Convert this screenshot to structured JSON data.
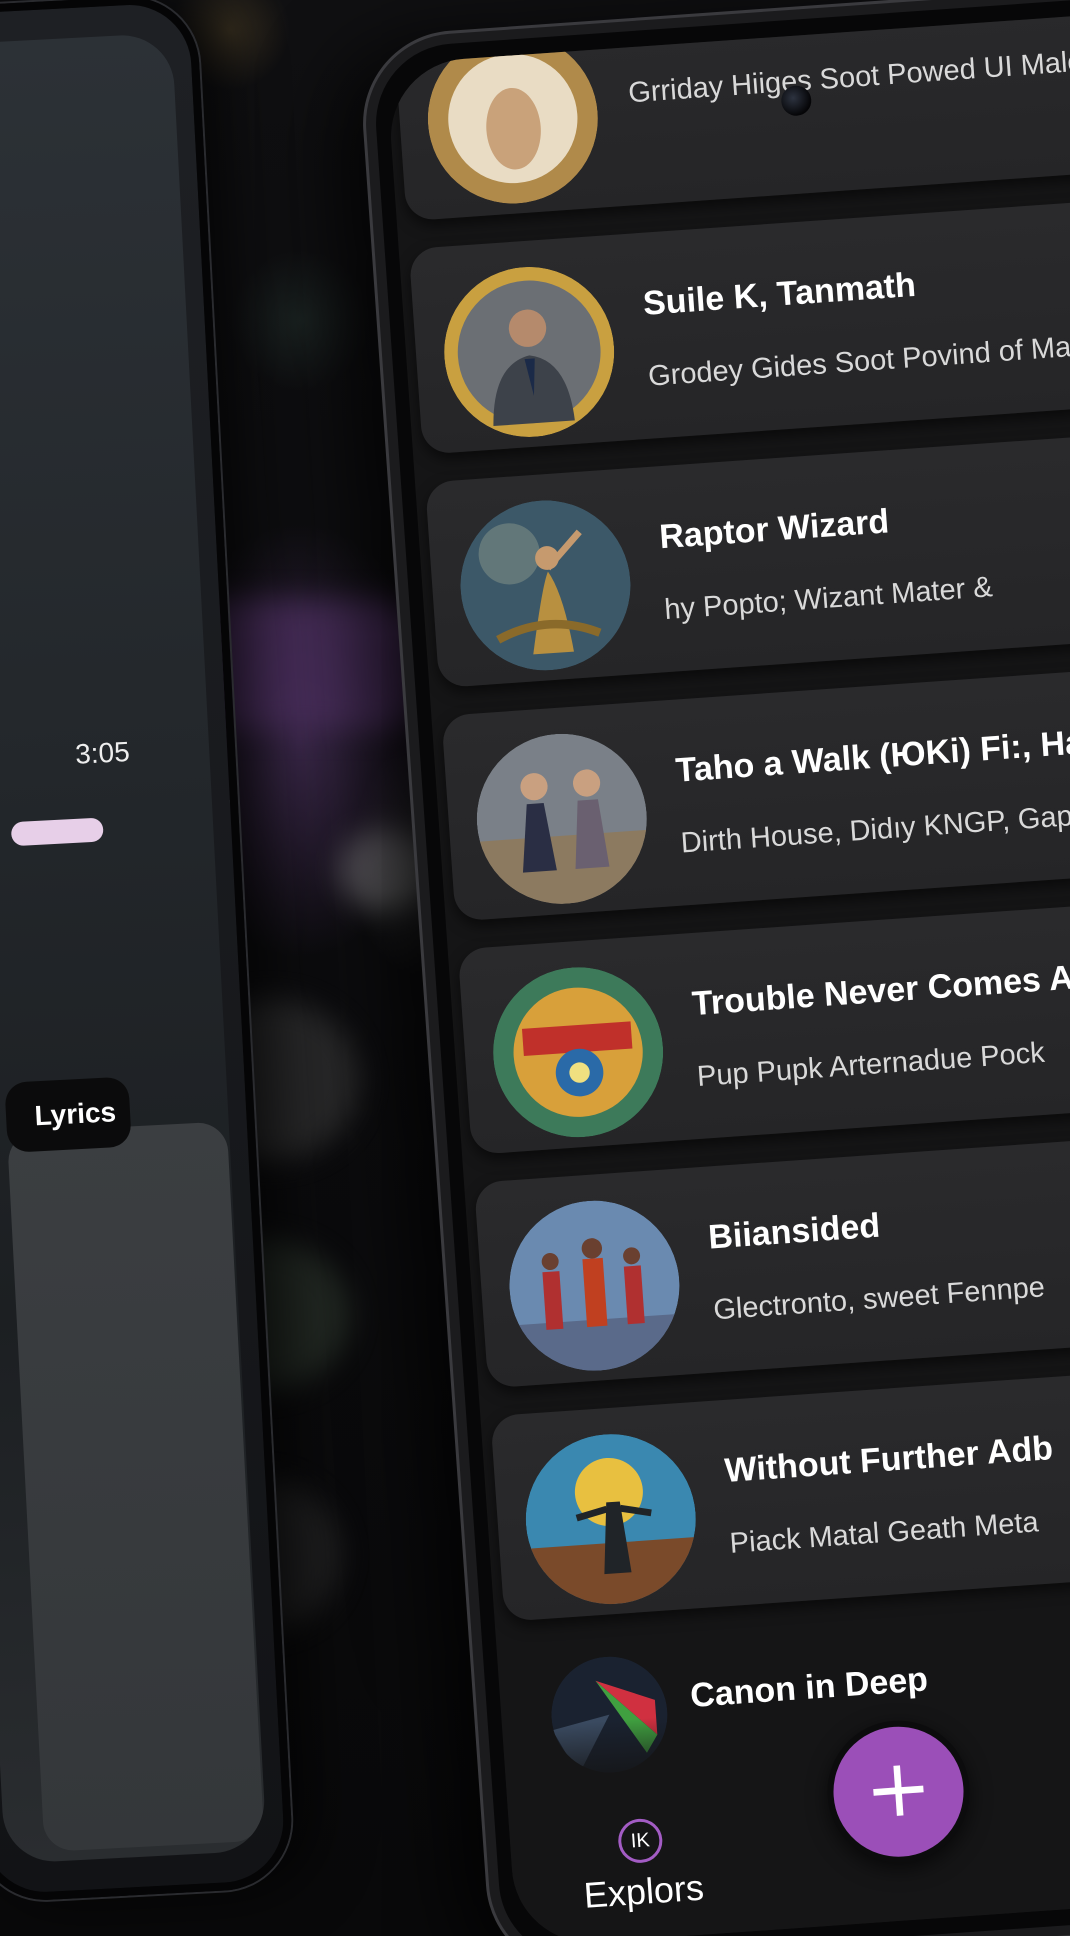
{
  "left_player": {
    "time": "3:05",
    "lyrics_label": "Lyrics"
  },
  "songs": [
    {
      "title": "",
      "subtitle": "Grriday Hiiges Soot Powed UI Malc"
    },
    {
      "title": "Suile K, Tanmath",
      "subtitle": "Grodey Gides Soot Povind of Ma"
    },
    {
      "title": "Raptor Wizard",
      "subtitle": "hy Popto; Wizant Mater &"
    },
    {
      "title": "Taho a Walk (ЮKi) Fi:, Har",
      "subtitle": "Dirth House, Didıy KNGP, Gap"
    },
    {
      "title": "Trouble Never Comes A",
      "subtitle": "Pup Pupk Arternadue Pock"
    },
    {
      "title": "Biiansided",
      "subtitle": "Glectronto, sweet Fennpe"
    },
    {
      "title": "Without Further Adb",
      "subtitle": "Piack Matal Geath Meta"
    },
    {
      "title": "Canon in Deep",
      "subtitle": ""
    }
  ],
  "art_icons": [
    "ornate-portrait-art",
    "businessman-portrait-art",
    "dancer-art",
    "two-women-art",
    "colorful-emblem-art",
    "dancers-group-art",
    "crowd-moon-art",
    "prism-art"
  ],
  "nav": {
    "explore_icon": "IK",
    "explore_label": "Explors",
    "fab_label": "+"
  },
  "colors": {
    "accent_purple": "#9b4fb8",
    "card_bg": "#2a2a2c",
    "screen_bg": "#151516",
    "progress_pink": "#e7cfe8"
  }
}
